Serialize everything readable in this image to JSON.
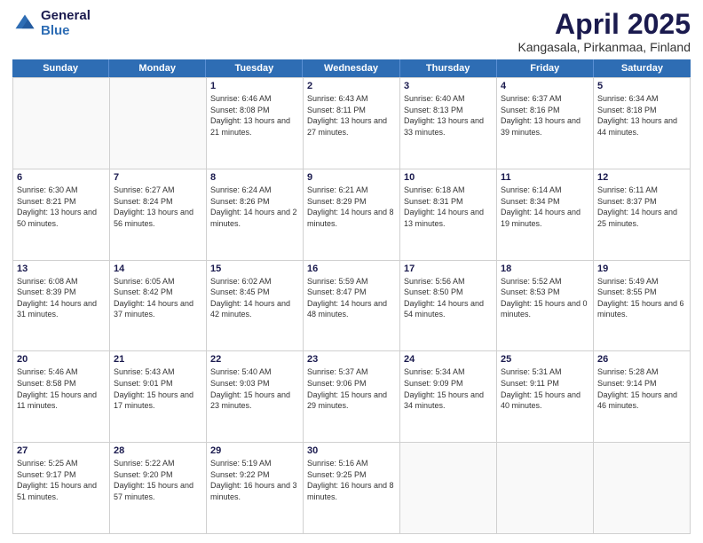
{
  "logo": {
    "general": "General",
    "blue": "Blue"
  },
  "title": {
    "month": "April 2025",
    "location": "Kangasala, Pirkanmaa, Finland"
  },
  "days": [
    "Sunday",
    "Monday",
    "Tuesday",
    "Wednesday",
    "Thursday",
    "Friday",
    "Saturday"
  ],
  "weeks": [
    [
      {
        "day": "",
        "sunrise": "",
        "sunset": "",
        "daylight": ""
      },
      {
        "day": "",
        "sunrise": "",
        "sunset": "",
        "daylight": ""
      },
      {
        "day": "1",
        "sunrise": "Sunrise: 6:46 AM",
        "sunset": "Sunset: 8:08 PM",
        "daylight": "Daylight: 13 hours and 21 minutes."
      },
      {
        "day": "2",
        "sunrise": "Sunrise: 6:43 AM",
        "sunset": "Sunset: 8:11 PM",
        "daylight": "Daylight: 13 hours and 27 minutes."
      },
      {
        "day": "3",
        "sunrise": "Sunrise: 6:40 AM",
        "sunset": "Sunset: 8:13 PM",
        "daylight": "Daylight: 13 hours and 33 minutes."
      },
      {
        "day": "4",
        "sunrise": "Sunrise: 6:37 AM",
        "sunset": "Sunset: 8:16 PM",
        "daylight": "Daylight: 13 hours and 39 minutes."
      },
      {
        "day": "5",
        "sunrise": "Sunrise: 6:34 AM",
        "sunset": "Sunset: 8:18 PM",
        "daylight": "Daylight: 13 hours and 44 minutes."
      }
    ],
    [
      {
        "day": "6",
        "sunrise": "Sunrise: 6:30 AM",
        "sunset": "Sunset: 8:21 PM",
        "daylight": "Daylight: 13 hours and 50 minutes."
      },
      {
        "day": "7",
        "sunrise": "Sunrise: 6:27 AM",
        "sunset": "Sunset: 8:24 PM",
        "daylight": "Daylight: 13 hours and 56 minutes."
      },
      {
        "day": "8",
        "sunrise": "Sunrise: 6:24 AM",
        "sunset": "Sunset: 8:26 PM",
        "daylight": "Daylight: 14 hours and 2 minutes."
      },
      {
        "day": "9",
        "sunrise": "Sunrise: 6:21 AM",
        "sunset": "Sunset: 8:29 PM",
        "daylight": "Daylight: 14 hours and 8 minutes."
      },
      {
        "day": "10",
        "sunrise": "Sunrise: 6:18 AM",
        "sunset": "Sunset: 8:31 PM",
        "daylight": "Daylight: 14 hours and 13 minutes."
      },
      {
        "day": "11",
        "sunrise": "Sunrise: 6:14 AM",
        "sunset": "Sunset: 8:34 PM",
        "daylight": "Daylight: 14 hours and 19 minutes."
      },
      {
        "day": "12",
        "sunrise": "Sunrise: 6:11 AM",
        "sunset": "Sunset: 8:37 PM",
        "daylight": "Daylight: 14 hours and 25 minutes."
      }
    ],
    [
      {
        "day": "13",
        "sunrise": "Sunrise: 6:08 AM",
        "sunset": "Sunset: 8:39 PM",
        "daylight": "Daylight: 14 hours and 31 minutes."
      },
      {
        "day": "14",
        "sunrise": "Sunrise: 6:05 AM",
        "sunset": "Sunset: 8:42 PM",
        "daylight": "Daylight: 14 hours and 37 minutes."
      },
      {
        "day": "15",
        "sunrise": "Sunrise: 6:02 AM",
        "sunset": "Sunset: 8:45 PM",
        "daylight": "Daylight: 14 hours and 42 minutes."
      },
      {
        "day": "16",
        "sunrise": "Sunrise: 5:59 AM",
        "sunset": "Sunset: 8:47 PM",
        "daylight": "Daylight: 14 hours and 48 minutes."
      },
      {
        "day": "17",
        "sunrise": "Sunrise: 5:56 AM",
        "sunset": "Sunset: 8:50 PM",
        "daylight": "Daylight: 14 hours and 54 minutes."
      },
      {
        "day": "18",
        "sunrise": "Sunrise: 5:52 AM",
        "sunset": "Sunset: 8:53 PM",
        "daylight": "Daylight: 15 hours and 0 minutes."
      },
      {
        "day": "19",
        "sunrise": "Sunrise: 5:49 AM",
        "sunset": "Sunset: 8:55 PM",
        "daylight": "Daylight: 15 hours and 6 minutes."
      }
    ],
    [
      {
        "day": "20",
        "sunrise": "Sunrise: 5:46 AM",
        "sunset": "Sunset: 8:58 PM",
        "daylight": "Daylight: 15 hours and 11 minutes."
      },
      {
        "day": "21",
        "sunrise": "Sunrise: 5:43 AM",
        "sunset": "Sunset: 9:01 PM",
        "daylight": "Daylight: 15 hours and 17 minutes."
      },
      {
        "day": "22",
        "sunrise": "Sunrise: 5:40 AM",
        "sunset": "Sunset: 9:03 PM",
        "daylight": "Daylight: 15 hours and 23 minutes."
      },
      {
        "day": "23",
        "sunrise": "Sunrise: 5:37 AM",
        "sunset": "Sunset: 9:06 PM",
        "daylight": "Daylight: 15 hours and 29 minutes."
      },
      {
        "day": "24",
        "sunrise": "Sunrise: 5:34 AM",
        "sunset": "Sunset: 9:09 PM",
        "daylight": "Daylight: 15 hours and 34 minutes."
      },
      {
        "day": "25",
        "sunrise": "Sunrise: 5:31 AM",
        "sunset": "Sunset: 9:11 PM",
        "daylight": "Daylight: 15 hours and 40 minutes."
      },
      {
        "day": "26",
        "sunrise": "Sunrise: 5:28 AM",
        "sunset": "Sunset: 9:14 PM",
        "daylight": "Daylight: 15 hours and 46 minutes."
      }
    ],
    [
      {
        "day": "27",
        "sunrise": "Sunrise: 5:25 AM",
        "sunset": "Sunset: 9:17 PM",
        "daylight": "Daylight: 15 hours and 51 minutes."
      },
      {
        "day": "28",
        "sunrise": "Sunrise: 5:22 AM",
        "sunset": "Sunset: 9:20 PM",
        "daylight": "Daylight: 15 hours and 57 minutes."
      },
      {
        "day": "29",
        "sunrise": "Sunrise: 5:19 AM",
        "sunset": "Sunset: 9:22 PM",
        "daylight": "Daylight: 16 hours and 3 minutes."
      },
      {
        "day": "30",
        "sunrise": "Sunrise: 5:16 AM",
        "sunset": "Sunset: 9:25 PM",
        "daylight": "Daylight: 16 hours and 8 minutes."
      },
      {
        "day": "",
        "sunrise": "",
        "sunset": "",
        "daylight": ""
      },
      {
        "day": "",
        "sunrise": "",
        "sunset": "",
        "daylight": ""
      },
      {
        "day": "",
        "sunrise": "",
        "sunset": "",
        "daylight": ""
      }
    ]
  ]
}
